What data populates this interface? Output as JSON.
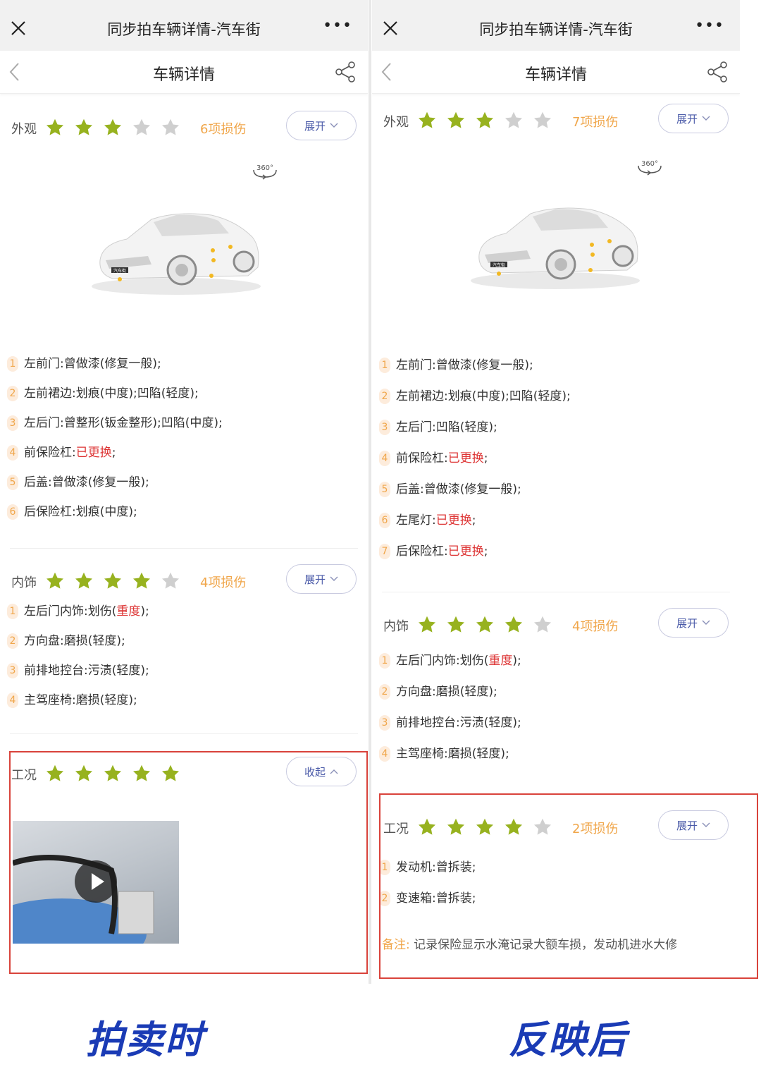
{
  "miniprogram": {
    "title": "同步拍车辆详情-汽车街"
  },
  "nav": {
    "title": "车辆详情"
  },
  "left": {
    "exterior": {
      "label": "外观",
      "stars": 3,
      "damage_count": "6项损伤",
      "toggle": "展开",
      "items": [
        {
          "n": "1",
          "part": "左前门:",
          "text": "曾做漆(修复一般);"
        },
        {
          "n": "2",
          "part": "左前裙边:",
          "text": "划痕(中度);凹陷(轻度);"
        },
        {
          "n": "3",
          "part": "左后门:",
          "text": "曾整形(钣金整形);凹陷(中度);"
        },
        {
          "n": "4",
          "part": "前保险杠:",
          "red": "已更换",
          "text": ";"
        },
        {
          "n": "5",
          "part": "后盖:",
          "text": "曾做漆(修复一般);"
        },
        {
          "n": "6",
          "part": "后保险杠:",
          "text": "划痕(中度);"
        }
      ]
    },
    "interior": {
      "label": "内饰",
      "stars": 4,
      "damage_count": "4项损伤",
      "toggle": "展开",
      "items": [
        {
          "n": "1",
          "part": "左后门内饰:",
          "text": "划伤(",
          "red": "重度",
          "tail": ");"
        },
        {
          "n": "2",
          "part": "方向盘:",
          "text": "磨损(轻度);"
        },
        {
          "n": "3",
          "part": "前排地控台:",
          "text": "污渍(轻度);"
        },
        {
          "n": "4",
          "part": "主驾座椅:",
          "text": "磨损(轻度);"
        }
      ]
    },
    "condition": {
      "label": "工况",
      "stars": 5,
      "toggle": "收起"
    },
    "caption": "拍卖时"
  },
  "right": {
    "exterior": {
      "label": "外观",
      "stars": 3,
      "damage_count": "7项损伤",
      "toggle": "展开",
      "items": [
        {
          "n": "1",
          "part": "左前门:",
          "text": "曾做漆(修复一般);"
        },
        {
          "n": "2",
          "part": "左前裙边:",
          "text": "划痕(中度);凹陷(轻度);"
        },
        {
          "n": "3",
          "part": "左后门:",
          "text": "凹陷(轻度);"
        },
        {
          "n": "4",
          "part": "前保险杠:",
          "red": "已更换",
          "text": ";"
        },
        {
          "n": "5",
          "part": "后盖:",
          "text": "曾做漆(修复一般);"
        },
        {
          "n": "6",
          "part": "左尾灯:",
          "red": "已更换",
          "text": ";"
        },
        {
          "n": "7",
          "part": "后保险杠:",
          "red": "已更换",
          "text": ";"
        }
      ]
    },
    "interior": {
      "label": "内饰",
      "stars": 4,
      "damage_count": "4项损伤",
      "toggle": "展开",
      "items": [
        {
          "n": "1",
          "part": "左后门内饰:",
          "text": "划伤(",
          "red": "重度",
          "tail": ");"
        },
        {
          "n": "2",
          "part": "方向盘:",
          "text": "磨损(轻度);"
        },
        {
          "n": "3",
          "part": "前排地控台:",
          "text": "污渍(轻度);"
        },
        {
          "n": "4",
          "part": "主驾座椅:",
          "text": "磨损(轻度);"
        }
      ]
    },
    "condition": {
      "label": "工况",
      "stars": 4,
      "damage_count": "2项损伤",
      "toggle": "展开",
      "items": [
        {
          "n": "1",
          "part": "发动机:",
          "text": "曾拆装;"
        },
        {
          "n": "2",
          "part": "变速箱:",
          "text": "曾拆装;"
        }
      ],
      "remark_label": "备注:",
      "remark_text": "记录保险显示水淹记录大额车损，发动机进水大修"
    },
    "caption": "反映后"
  },
  "rotate_badge": "360°",
  "plate_text": "汽车街",
  "colors": {
    "star_on": "#97b21f",
    "star_off": "#cfcfcf",
    "damage": "#f0a64a",
    "red": "#d33",
    "highlight_box": "#d9433b",
    "caption": "#1a3bb5"
  }
}
